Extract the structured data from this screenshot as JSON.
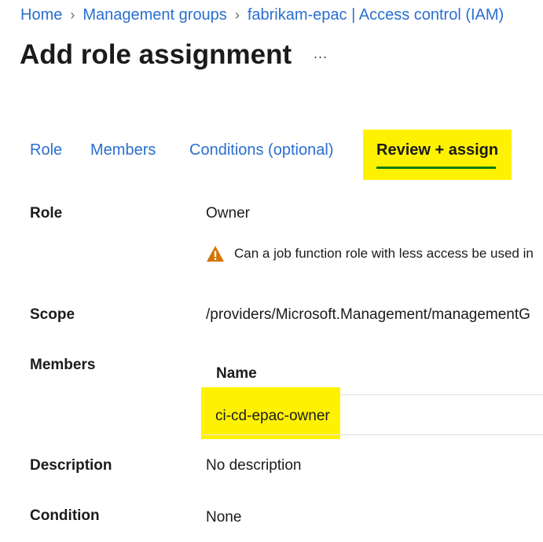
{
  "breadcrumb": {
    "items": [
      "Home",
      "Management groups",
      "fabrikam-epac | Access control (IAM)"
    ],
    "separator": ">"
  },
  "header": {
    "title": "Add role assignment",
    "more": "..."
  },
  "tabs": [
    {
      "label": "Role"
    },
    {
      "label": "Members"
    },
    {
      "label": "Conditions (optional)"
    },
    {
      "label": "Review + assign"
    }
  ],
  "review": {
    "role_label": "Role",
    "role_value": "Owner",
    "role_warning": "Can a job function role with less access be used in",
    "scope_label": "Scope",
    "scope_value": "/providers/Microsoft.Management/managementG",
    "members_label": "Members",
    "members_table_header": "Name",
    "members": [
      "ci-cd-epac-owner"
    ],
    "description_label": "Description",
    "description_value": "No description",
    "condition_label": "Condition",
    "condition_value": "None"
  },
  "colors": {
    "link": "#2a6fcf",
    "highlight": "#fff200",
    "active_tab_underline": "#107c10",
    "warning": "#d47500"
  },
  "active_tab_index": 3
}
